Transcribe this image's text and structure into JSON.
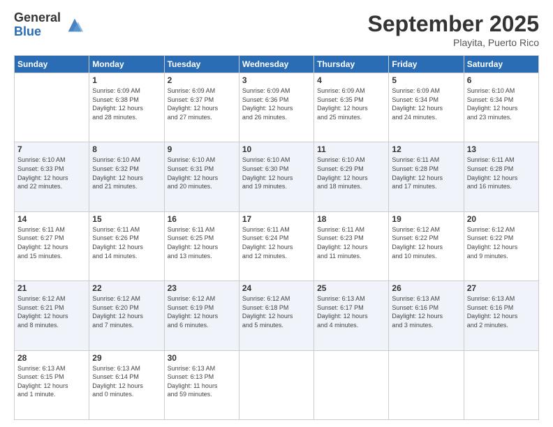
{
  "logo": {
    "general": "General",
    "blue": "Blue"
  },
  "title": "September 2025",
  "location": "Playita, Puerto Rico",
  "days_of_week": [
    "Sunday",
    "Monday",
    "Tuesday",
    "Wednesday",
    "Thursday",
    "Friday",
    "Saturday"
  ],
  "weeks": [
    [
      {
        "day": "",
        "info": ""
      },
      {
        "day": "1",
        "info": "Sunrise: 6:09 AM\nSunset: 6:38 PM\nDaylight: 12 hours\nand 28 minutes."
      },
      {
        "day": "2",
        "info": "Sunrise: 6:09 AM\nSunset: 6:37 PM\nDaylight: 12 hours\nand 27 minutes."
      },
      {
        "day": "3",
        "info": "Sunrise: 6:09 AM\nSunset: 6:36 PM\nDaylight: 12 hours\nand 26 minutes."
      },
      {
        "day": "4",
        "info": "Sunrise: 6:09 AM\nSunset: 6:35 PM\nDaylight: 12 hours\nand 25 minutes."
      },
      {
        "day": "5",
        "info": "Sunrise: 6:09 AM\nSunset: 6:34 PM\nDaylight: 12 hours\nand 24 minutes."
      },
      {
        "day": "6",
        "info": "Sunrise: 6:10 AM\nSunset: 6:34 PM\nDaylight: 12 hours\nand 23 minutes."
      }
    ],
    [
      {
        "day": "7",
        "info": "Sunrise: 6:10 AM\nSunset: 6:33 PM\nDaylight: 12 hours\nand 22 minutes."
      },
      {
        "day": "8",
        "info": "Sunrise: 6:10 AM\nSunset: 6:32 PM\nDaylight: 12 hours\nand 21 minutes."
      },
      {
        "day": "9",
        "info": "Sunrise: 6:10 AM\nSunset: 6:31 PM\nDaylight: 12 hours\nand 20 minutes."
      },
      {
        "day": "10",
        "info": "Sunrise: 6:10 AM\nSunset: 6:30 PM\nDaylight: 12 hours\nand 19 minutes."
      },
      {
        "day": "11",
        "info": "Sunrise: 6:10 AM\nSunset: 6:29 PM\nDaylight: 12 hours\nand 18 minutes."
      },
      {
        "day": "12",
        "info": "Sunrise: 6:11 AM\nSunset: 6:28 PM\nDaylight: 12 hours\nand 17 minutes."
      },
      {
        "day": "13",
        "info": "Sunrise: 6:11 AM\nSunset: 6:28 PM\nDaylight: 12 hours\nand 16 minutes."
      }
    ],
    [
      {
        "day": "14",
        "info": "Sunrise: 6:11 AM\nSunset: 6:27 PM\nDaylight: 12 hours\nand 15 minutes."
      },
      {
        "day": "15",
        "info": "Sunrise: 6:11 AM\nSunset: 6:26 PM\nDaylight: 12 hours\nand 14 minutes."
      },
      {
        "day": "16",
        "info": "Sunrise: 6:11 AM\nSunset: 6:25 PM\nDaylight: 12 hours\nand 13 minutes."
      },
      {
        "day": "17",
        "info": "Sunrise: 6:11 AM\nSunset: 6:24 PM\nDaylight: 12 hours\nand 12 minutes."
      },
      {
        "day": "18",
        "info": "Sunrise: 6:11 AM\nSunset: 6:23 PM\nDaylight: 12 hours\nand 11 minutes."
      },
      {
        "day": "19",
        "info": "Sunrise: 6:12 AM\nSunset: 6:22 PM\nDaylight: 12 hours\nand 10 minutes."
      },
      {
        "day": "20",
        "info": "Sunrise: 6:12 AM\nSunset: 6:22 PM\nDaylight: 12 hours\nand 9 minutes."
      }
    ],
    [
      {
        "day": "21",
        "info": "Sunrise: 6:12 AM\nSunset: 6:21 PM\nDaylight: 12 hours\nand 8 minutes."
      },
      {
        "day": "22",
        "info": "Sunrise: 6:12 AM\nSunset: 6:20 PM\nDaylight: 12 hours\nand 7 minutes."
      },
      {
        "day": "23",
        "info": "Sunrise: 6:12 AM\nSunset: 6:19 PM\nDaylight: 12 hours\nand 6 minutes."
      },
      {
        "day": "24",
        "info": "Sunrise: 6:12 AM\nSunset: 6:18 PM\nDaylight: 12 hours\nand 5 minutes."
      },
      {
        "day": "25",
        "info": "Sunrise: 6:13 AM\nSunset: 6:17 PM\nDaylight: 12 hours\nand 4 minutes."
      },
      {
        "day": "26",
        "info": "Sunrise: 6:13 AM\nSunset: 6:16 PM\nDaylight: 12 hours\nand 3 minutes."
      },
      {
        "day": "27",
        "info": "Sunrise: 6:13 AM\nSunset: 6:16 PM\nDaylight: 12 hours\nand 2 minutes."
      }
    ],
    [
      {
        "day": "28",
        "info": "Sunrise: 6:13 AM\nSunset: 6:15 PM\nDaylight: 12 hours\nand 1 minute."
      },
      {
        "day": "29",
        "info": "Sunrise: 6:13 AM\nSunset: 6:14 PM\nDaylight: 12 hours\nand 0 minutes."
      },
      {
        "day": "30",
        "info": "Sunrise: 6:13 AM\nSunset: 6:13 PM\nDaylight: 11 hours\nand 59 minutes."
      },
      {
        "day": "",
        "info": ""
      },
      {
        "day": "",
        "info": ""
      },
      {
        "day": "",
        "info": ""
      },
      {
        "day": "",
        "info": ""
      }
    ]
  ]
}
